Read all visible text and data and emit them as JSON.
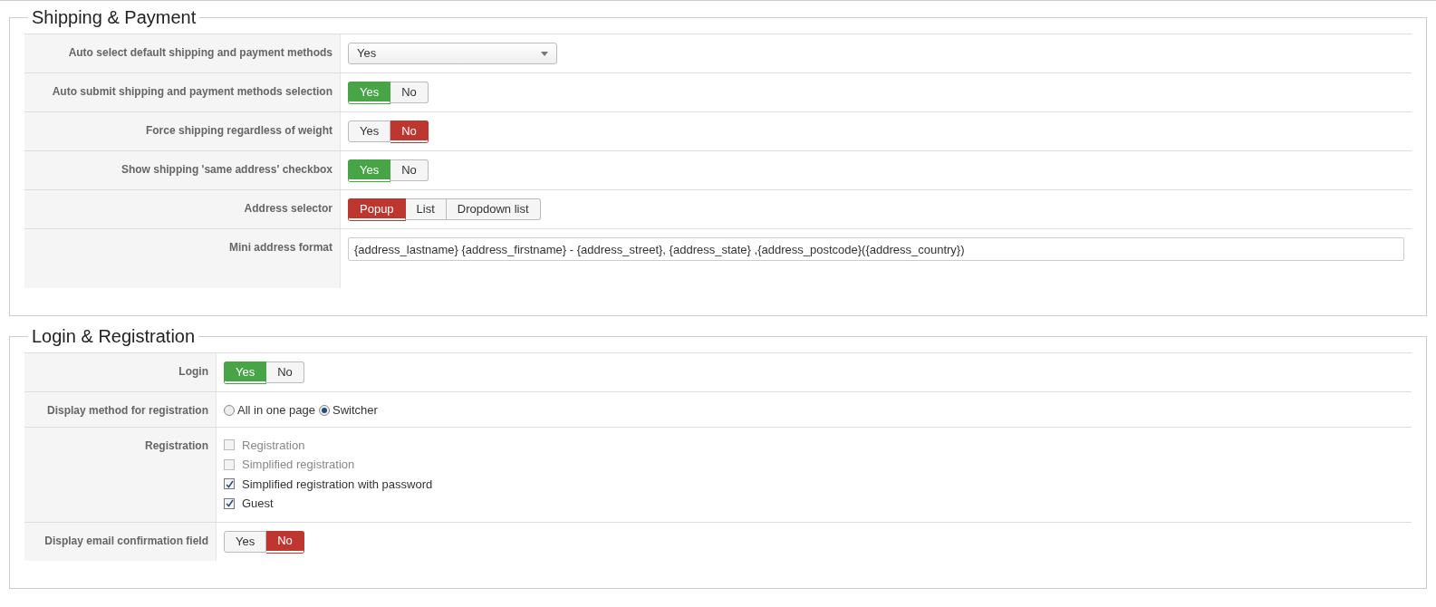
{
  "sections": [
    {
      "legend": "Shipping & Payment",
      "rows": [
        {
          "label": "Auto select default shipping and payment methods",
          "kind": "select",
          "value": "Yes"
        },
        {
          "label": "Auto submit shipping and payment methods selection",
          "kind": "toggle",
          "options": [
            {
              "label": "Yes",
              "selected": true,
              "color": "#47a447"
            },
            {
              "label": "No",
              "selected": false
            }
          ]
        },
        {
          "label": "Force shipping regardless of weight",
          "kind": "toggle",
          "options": [
            {
              "label": "Yes",
              "selected": false
            },
            {
              "label": "No",
              "selected": true,
              "color": "#bd362f"
            }
          ]
        },
        {
          "label": "Show shipping 'same address' checkbox",
          "kind": "toggle",
          "options": [
            {
              "label": "Yes",
              "selected": true,
              "color": "#47a447"
            },
            {
              "label": "No",
              "selected": false
            }
          ]
        },
        {
          "label": "Address selector",
          "kind": "toggle",
          "options": [
            {
              "label": "Popup",
              "selected": true,
              "color": "#bd362f"
            },
            {
              "label": "List",
              "selected": false
            },
            {
              "label": "Dropdown list",
              "selected": false
            }
          ]
        },
        {
          "label": "Mini address format",
          "kind": "text",
          "value": "{address_lastname} {address_firstname} - {address_street}, {address_state} ,{address_postcode}({address_country})"
        }
      ]
    },
    {
      "legend": "Login & Registration",
      "rows": [
        {
          "label": "Login",
          "kind": "toggle",
          "options": [
            {
              "label": "Yes",
              "selected": true,
              "color": "#47a447"
            },
            {
              "label": "No",
              "selected": false
            }
          ]
        },
        {
          "label": "Display method for registration",
          "kind": "radio",
          "options": [
            {
              "label": "All in one page",
              "selected": false
            },
            {
              "label": "Switcher",
              "selected": true
            }
          ]
        },
        {
          "label": "Registration",
          "kind": "checkboxes",
          "options": [
            {
              "label": "Registration",
              "checked": false,
              "disabled": true
            },
            {
              "label": "Simplified registration",
              "checked": false,
              "disabled": true
            },
            {
              "label": "Simplified registration with password",
              "checked": true,
              "disabled": false
            },
            {
              "label": "Guest",
              "checked": true,
              "disabled": false
            }
          ]
        },
        {
          "label": "Display email confirmation field",
          "kind": "toggle",
          "options": [
            {
              "label": "Yes",
              "selected": false
            },
            {
              "label": "No",
              "selected": true,
              "color": "#bd362f"
            }
          ]
        }
      ]
    }
  ]
}
